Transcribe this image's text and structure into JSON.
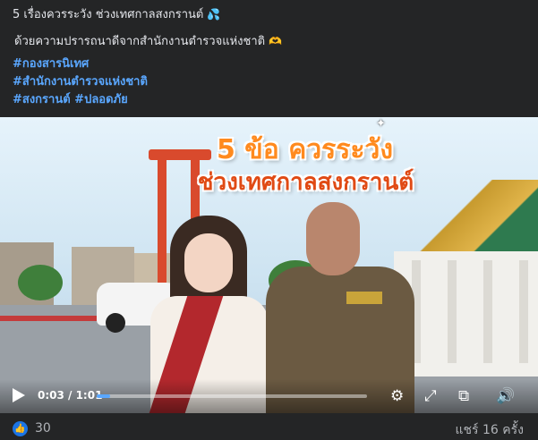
{
  "post": {
    "line1": "5 เรื่องควรระวัง ช่วงเทศกาลสงกรานต์",
    "line1_emoji": "💦",
    "line2": "ด้วยความปรารถนาดีจากสำนักงานตำรวจแห่งชาติ",
    "line2_emoji": "🫶",
    "hashtags": [
      "#กองสารนิเทศ",
      "#สำนักงานตำรวจแห่งชาติ",
      "#สงกรานต์ #ปลอดภัย"
    ]
  },
  "video": {
    "overlay_line1": "5 ข้อ ควรระวัง",
    "overlay_line2": "ช่วงเทศกาลสงกรานต์",
    "time_display": "0:03 / 1:01",
    "progress_fraction": 0.05,
    "icons": {
      "play": "play-icon",
      "settings": "gear-icon",
      "fullscreen": "expand-icon",
      "pip": "picture-in-picture-icon",
      "volume": "volume-icon"
    }
  },
  "footer": {
    "like_count": "30",
    "shares": "แชร์ 16 ครั้ง"
  },
  "colors": {
    "accent": "#1b74e4",
    "hashtag": "#5aa7ff",
    "background": "#242526"
  }
}
